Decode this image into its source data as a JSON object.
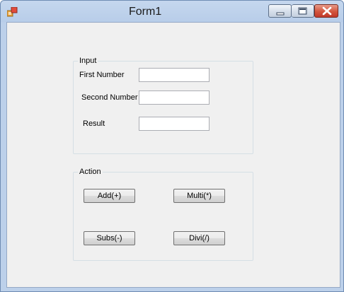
{
  "window": {
    "title": "Form1",
    "icons": {
      "app": "app-icon",
      "minimize": "minimize-icon",
      "maximize": "maximize-icon",
      "close": "close-icon"
    }
  },
  "input_group": {
    "caption": "Input",
    "first_number": {
      "label": "First Number",
      "value": ""
    },
    "second_number": {
      "label": "Second Number",
      "value": ""
    },
    "result": {
      "label": "Result",
      "value": ""
    }
  },
  "action_group": {
    "caption": "Action",
    "add_label": "Add(+)",
    "multi_label": "Multi(*)",
    "subs_label": "Subs(-)",
    "divi_label": "Divi(/)"
  }
}
